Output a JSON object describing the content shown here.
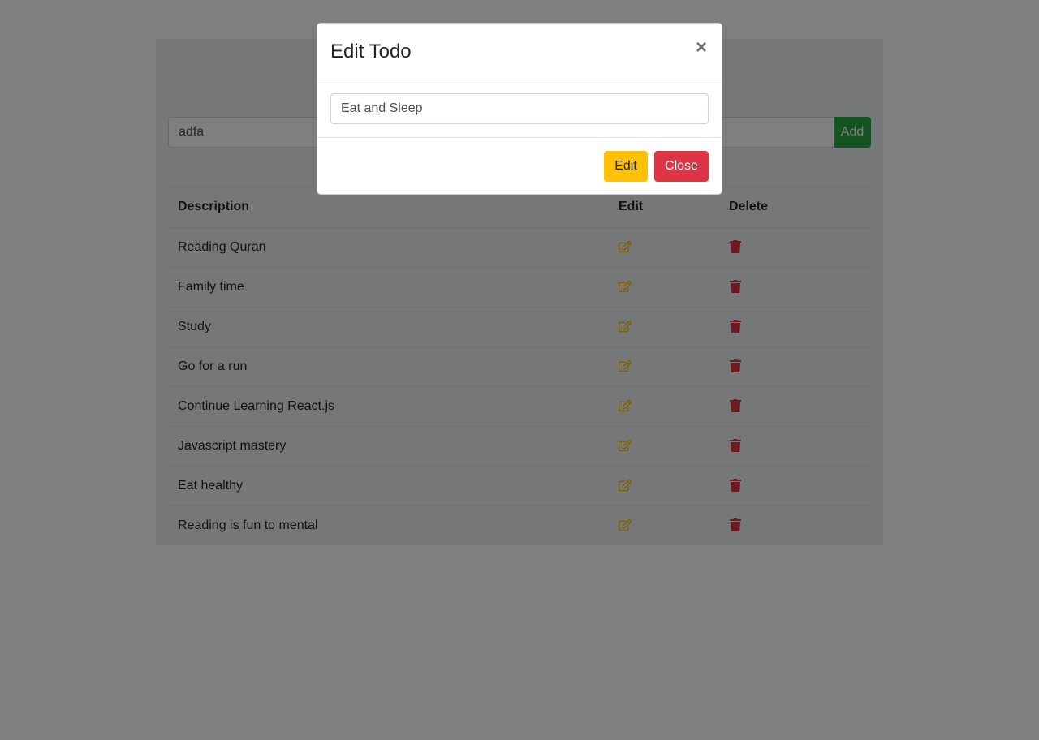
{
  "todo": {
    "input_value": "adfa",
    "add_label": "Add"
  },
  "table": {
    "headers": [
      "Description",
      "Edit",
      "Delete"
    ],
    "rows": [
      "Reading Quran",
      "Family time",
      "Study",
      "Go for a run",
      "Continue Learning React.js",
      "Javascript mastery",
      "Eat healthy",
      "Reading is fun to mental"
    ],
    "edit_icon": "edit-icon",
    "delete_icon": "trash-icon"
  },
  "modal": {
    "title": "Edit Todo",
    "close_symbol": "×",
    "input_value": "Eat and Sleep",
    "edit_label": "Edit",
    "close_label": "Close"
  },
  "colors": {
    "warning": "#ffc107",
    "danger": "#dc3545",
    "success": "#28a745"
  }
}
